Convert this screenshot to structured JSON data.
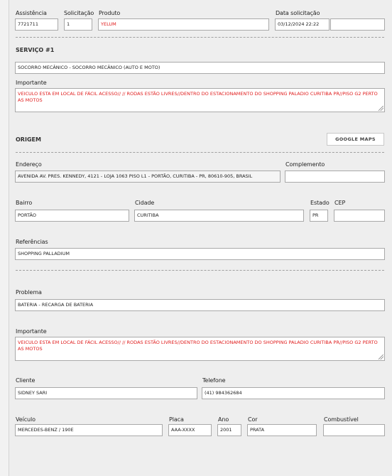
{
  "header": {
    "assistencia_label": "Assistência",
    "assistencia_value": "7721711",
    "solicitacao_label": "Solicitação",
    "solicitacao_value": "1",
    "produto_label": "Produto",
    "produto_value": "YELUM",
    "data_label": "Data solicitação",
    "data_value": "03/12/2024 22:22",
    "extra_value": ""
  },
  "servico": {
    "title": "SERVIÇO #1",
    "value": "SOCORRO MECÂNICO - SOCORRO MECÂNICO (AUTO E MOTO)",
    "importante_label": "Importante",
    "importante_text": "VEICULO ESTA EM LOCAL DE FÁCIL ACESSO// // RODAS ESTÃO LIVRES//DENTRO DO ESTACIONAMENTO DO SHOPPING PALADIO CURITIBA PR//PISO G2 PERTO AS MOTOS"
  },
  "origem": {
    "title": "ORIGEM",
    "maps_button": "GOOGLE MAPS",
    "endereco_label": "Endereço",
    "endereco_value": "AVENIDA AV. PRES. KENNEDY, 4121 - LOJA 1063 PISO L1 - PORTÃO, CURITIBA - PR, 80610-905, BRASIL",
    "complemento_label": "Complemento",
    "complemento_value": "",
    "bairro_label": "Bairro",
    "bairro_value": "PORTÃO",
    "cidade_label": "Cidade",
    "cidade_value": "CURITIBA",
    "estado_label": "Estado",
    "estado_value": "PR",
    "cep_label": "CEP",
    "cep_value": "",
    "referencias_label": "Referências",
    "referencias_value": "SHOPPING PALLADIUM"
  },
  "detalhes": {
    "problema_label": "Problema",
    "problema_value": "BATERIA - RECARGA DE BATERIA",
    "importante_label": "Importante",
    "importante_text": "VEICULO ESTA EM LOCAL DE FÁCIL ACESSO// // RODAS ESTÃO LIVRES//DENTRO DO ESTACIONAMENTO DO SHOPPING PALADIO CURITIBA PR//PISO G2 PERTO AS MOTOS",
    "cliente_label": "Cliente",
    "cliente_value": "SIDNEY SARI",
    "telefone_label": "Telefone",
    "telefone_value": "(41) 984362684",
    "veiculo_label": "Veículo",
    "veiculo_value": "MERCEDES-BENZ / 190E",
    "placa_label": "Placa",
    "placa_value": "AAA-XXXX",
    "ano_label": "Ano",
    "ano_value": "2001",
    "cor_label": "Cor",
    "cor_value": "PRATA",
    "combustivel_label": "Combustível",
    "combustivel_value": ""
  }
}
